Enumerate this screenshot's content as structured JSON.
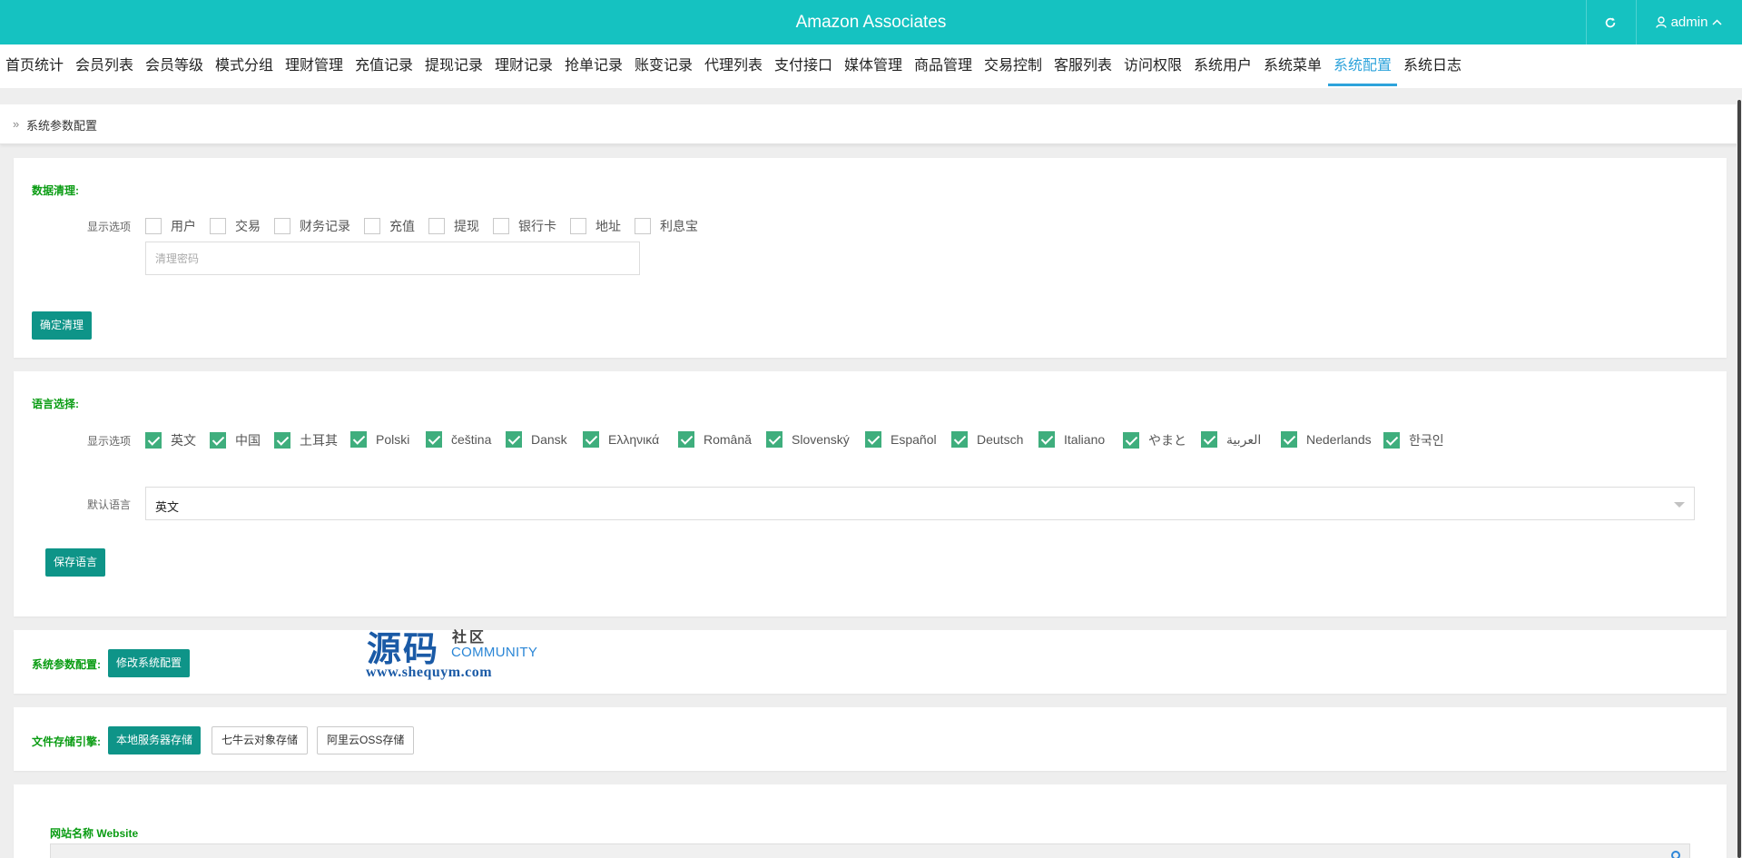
{
  "header": {
    "app_title": "Amazon Associates",
    "user_name": "admin",
    "accent_color": "#15c2c1"
  },
  "nav": {
    "items": [
      "首页统计",
      "会员列表",
      "会员等级",
      "模式分组",
      "理财管理",
      "充值记录",
      "提现记录",
      "理财记录",
      "抢单记录",
      "账变记录",
      "代理列表",
      "支付接口",
      "媒体管理",
      "商品管理",
      "交易控制",
      "客服列表",
      "访问权限",
      "系统用户",
      "系统菜单",
      "系统配置",
      "系统日志"
    ],
    "active": "系统配置",
    "active_color": "#2da3db"
  },
  "breadcrumb": {
    "title": "系统参数配置"
  },
  "data_cleanup": {
    "title": "数据清理:",
    "options_label": "显示选项",
    "options": [
      "用户",
      "交易",
      "财务记录",
      "充值",
      "提现",
      "银行卡",
      "地址",
      "利息宝"
    ],
    "password_placeholder": "清理密码",
    "confirm_button": "确定清理"
  },
  "language": {
    "title": "语言选择:",
    "options_label": "显示选项",
    "options": [
      "英文",
      "中国",
      "土耳其",
      "Polski",
      "čeština",
      "Dansk",
      "Ελληνικά",
      "Română",
      "Slovenský",
      "Español",
      "Deutsch",
      "Italiano",
      "やまと",
      "العربية",
      "Nederlands",
      "한국인"
    ],
    "all_checked": true,
    "default_label": "默认语言",
    "default_value": "英文",
    "save_button": "保存语言"
  },
  "system_params": {
    "title": "系统参数配置:",
    "edit_button": "修改系统配置"
  },
  "storage": {
    "title": "文件存储引擎:",
    "options": [
      "本地服务器存储",
      "七牛云对象存储",
      "阿里云OSS存储"
    ],
    "selected": "本地服务器存储"
  },
  "website": {
    "label": "网站名称 Website"
  },
  "watermark": {
    "main": "源码",
    "side": "社区",
    "community": "COMMUNITY",
    "url": "www.shequym.com"
  }
}
